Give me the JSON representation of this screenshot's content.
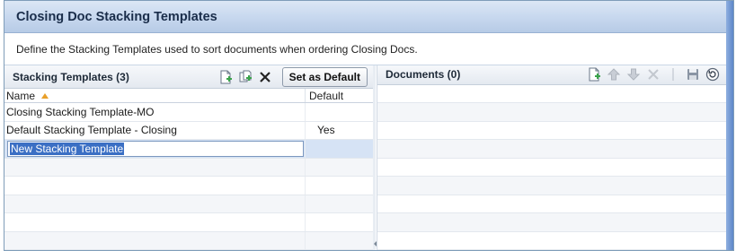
{
  "window": {
    "title": "Closing Doc Stacking Templates"
  },
  "description": "Define the Stacking Templates used to sort documents when ordering Closing Docs.",
  "left_pane": {
    "title": "Stacking Templates (3)",
    "set_default_label": "Set as Default",
    "columns": {
      "name": "Name",
      "default": "Default"
    },
    "rows": [
      {
        "name": "Closing Stacking Template-MO",
        "default": ""
      },
      {
        "name": "Default Stacking Template - Closing",
        "default": "Yes"
      }
    ],
    "editing_row": {
      "value": "New Stacking Template"
    }
  },
  "right_pane": {
    "title": "Documents (0)"
  },
  "colors": {
    "accent": "#3b6fc4",
    "title_bar": "#c6d7ee",
    "add_icon_green": "#3aa34a",
    "delete_dark": "#222222"
  },
  "icons": {
    "left_toolbar": [
      "add-document-icon",
      "copy-document-icon",
      "delete-x-icon"
    ],
    "right_toolbar": [
      "add-document-icon",
      "move-up-arrow-icon",
      "move-down-arrow-icon",
      "delete-x-icon",
      "save-disk-icon",
      "refresh-icon"
    ]
  }
}
